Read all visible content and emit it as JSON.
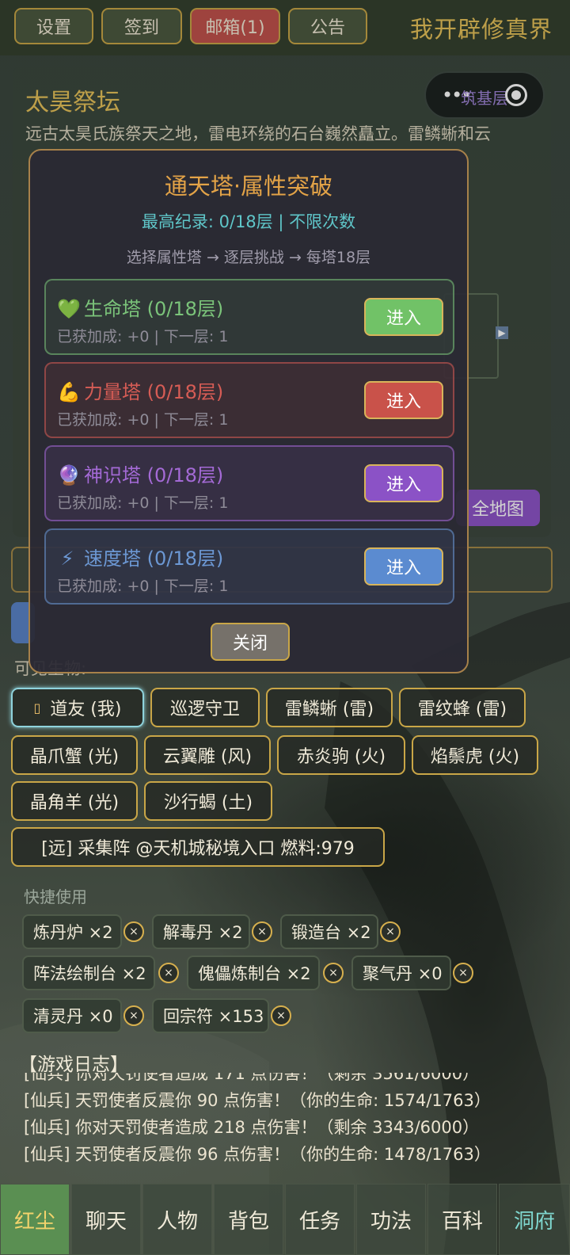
{
  "topbar": {
    "buttons": [
      {
        "label": "设置"
      },
      {
        "label": "签到"
      },
      {
        "label": "邮箱(1)"
      },
      {
        "label": "公告"
      }
    ],
    "game_title": "我开辟修真界"
  },
  "location": {
    "title": "太昊祭坛",
    "description": "远古太昊氏族祭天之地，雷电环绕的石台巍然矗立。雷鳞蜥和云",
    "full_map_label": "全地图",
    "recording_label": "筑基层"
  },
  "modal": {
    "title": "通天塔·属性突破",
    "record": "最高纪录: 0/18层 | 不限次数",
    "hint": "选择属性塔 → 逐层挑战 → 每塔18层",
    "towers": [
      {
        "icon": "💚",
        "name": "生命塔 (0/18层)",
        "info": "已获加成: +0 | 下一层: 1",
        "enter": "进入",
        "color": "#7bc47a",
        "btn": "#71c267"
      },
      {
        "icon": "💪",
        "name": "力量塔 (0/18层)",
        "info": "已获加成: +0 | 下一层: 1",
        "enter": "进入",
        "color": "#d65c55",
        "btn": "#c9524a"
      },
      {
        "icon": "🔮",
        "name": "神识塔 (0/18层)",
        "info": "已获加成: +0 | 下一层: 1",
        "enter": "进入",
        "color": "#a46ad6",
        "btn": "#8b52c6"
      },
      {
        "icon": "⚡",
        "name": "速度塔 (0/18层)",
        "info": "已获加成: +0 | 下一层: 1",
        "enter": "进入",
        "color": "#6c98d4",
        "btn": "#5b8bd0"
      }
    ],
    "close_label": "关闭"
  },
  "nearby": {
    "label": "可见生物:",
    "chips": [
      {
        "label": "道友 (我)"
      },
      {
        "label": "巡逻守卫"
      },
      {
        "label": "雷鳞蜥 (雷)"
      },
      {
        "label": "雷纹蜂 (雷)"
      },
      {
        "label": "晶爪蟹 (光)"
      },
      {
        "label": "云翼雕 (风)"
      },
      {
        "label": "赤炎驹 (火)"
      },
      {
        "label": "焰鬃虎 (火)"
      },
      {
        "label": "晶角羊 (光)"
      },
      {
        "label": "沙行蝎 (土)"
      },
      {
        "label": "[远] 采集阵 @天机城秘境入口 燃料:979"
      }
    ]
  },
  "quick_use": {
    "label": "快捷使用",
    "items": [
      {
        "label": "炼丹炉 ×2"
      },
      {
        "label": "解毒丹 ×2"
      },
      {
        "label": "锻造台 ×2"
      },
      {
        "label": "阵法绘制台 ×2"
      },
      {
        "label": "傀儡炼制台 ×2"
      },
      {
        "label": "聚气丹 ×0"
      },
      {
        "label": "清灵丹 ×0"
      },
      {
        "label": "回宗符 ×153"
      }
    ],
    "remove_glyph": "×"
  },
  "log": {
    "title": "【游戏日志】",
    "lines": [
      "[仙兵] 你对天罚使者造成 171 点伤害！（剩余 3561/6000）",
      "[仙兵] 天罚使者反震你 90 点伤害！（你的生命: 1574/1763）",
      "[仙兵] 你对天罚使者造成 218 点伤害！（剩余 3343/6000）",
      "[仙兵] 天罚使者反震你 96 点伤害！（你的生命: 1478/1763）"
    ]
  },
  "bottom_nav": {
    "tabs": [
      {
        "label": "红尘"
      },
      {
        "label": "聊天"
      },
      {
        "label": "人物"
      },
      {
        "label": "背包"
      },
      {
        "label": "任务"
      },
      {
        "label": "功法"
      },
      {
        "label": "百科"
      },
      {
        "label": "洞府"
      }
    ]
  }
}
